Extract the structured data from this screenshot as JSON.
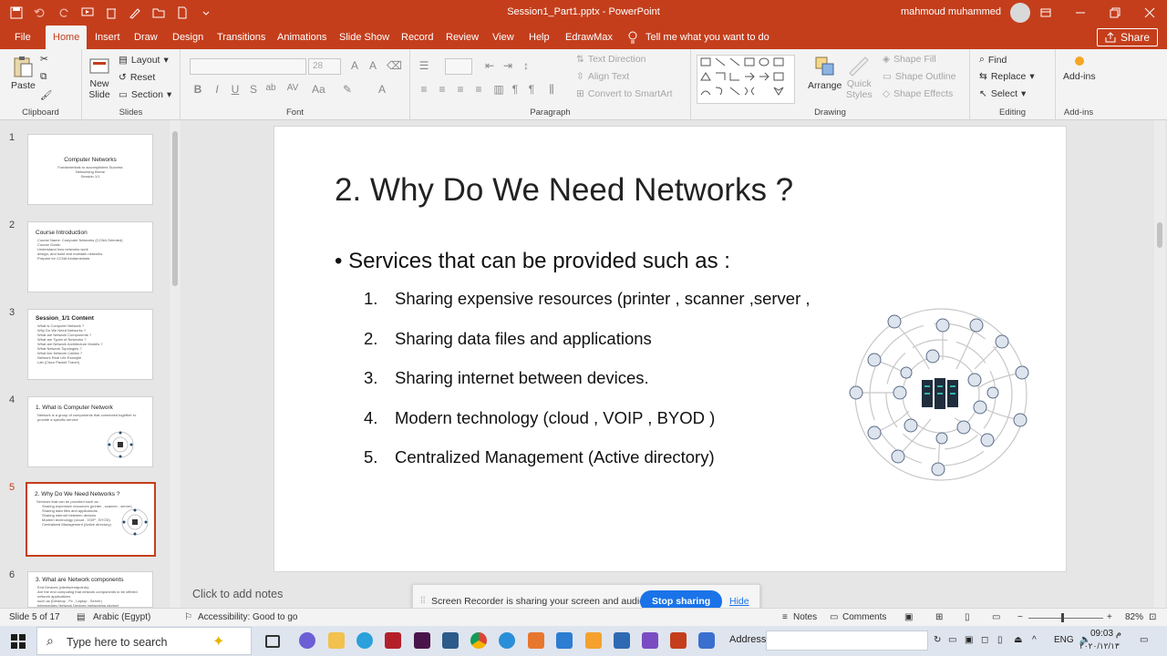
{
  "window": {
    "title": "Session1_Part1.pptx - PowerPoint",
    "user": "mahmoud muhammed"
  },
  "tabs": [
    "File",
    "Home",
    "Insert",
    "Draw",
    "Design",
    "Transitions",
    "Animations",
    "Slide Show",
    "Record",
    "Review",
    "View",
    "Help",
    "EdrawMax"
  ],
  "tell_me": "Tell me what you want to do",
  "share_label": "Share",
  "ribbon": {
    "clipboard": {
      "paste": "Paste",
      "label": "Clipboard"
    },
    "slides": {
      "new_slide_1": "New",
      "new_slide_2": "Slide",
      "layout": "Layout",
      "reset": "Reset",
      "section": "Section",
      "label": "Slides"
    },
    "font": {
      "label": "Font",
      "size": "28"
    },
    "paragraph": {
      "text_direction": "Text Direction",
      "align_text": "Align Text",
      "convert_smartart": "Convert to SmartArt",
      "label": "Paragraph"
    },
    "drawing": {
      "arrange": "Arrange",
      "quick_styles_1": "Quick",
      "quick_styles_2": "Styles",
      "shape_fill": "Shape Fill",
      "shape_outline": "Shape Outline",
      "shape_effects": "Shape Effects",
      "label": "Drawing"
    },
    "editing": {
      "find": "Find",
      "replace": "Replace",
      "select": "Select",
      "label": "Editing"
    },
    "addins": {
      "addins": "Add-ins",
      "label": "Add-ins"
    }
  },
  "thumbnails": [
    {
      "num": "1",
      "title": "Computer Networks",
      "lines": [
        "Fundamentals to accomplishes Success",
        "Networking theme",
        "Session 1/1"
      ]
    },
    {
      "num": "2",
      "title": "Course Introduction",
      "lines": [
        "Course Name: Computer Networks (CCNA Oriented)",
        "Course Goals:",
        "Understand how networks work",
        "design, and build and maintain networks",
        "Prepare for CCNA fundamentals"
      ]
    },
    {
      "num": "3",
      "title": "Session_1/1 Content",
      "lines": [
        "What is Computer Network ?",
        "Why Do We Need Networks ?",
        "What are Network Components ?",
        "What are Types of Networks ?",
        "What are Network Architecture Models ?",
        "What Network Topologies ?",
        "What Are Network Cables ?",
        "Network Real Life Example",
        "Lab (Cisco Packet Tracer)"
      ]
    },
    {
      "num": "4",
      "title": "1. What is Computer Network",
      "lines": [
        "Network is a group of components that connected together to",
        "provide a specific service"
      ]
    },
    {
      "num": "5",
      "title": "2. Why Do We Need Networks ?",
      "lines": [
        "Services that can be provided such as :",
        "Sharing expensive resources (printer , scanner , server)",
        "Sharing data files and applications",
        "Sharing internet between devices",
        "Modern technology (cloud , VOIP , BYOD)",
        "Centralized Management (Active directory)"
      ]
    },
    {
      "num": "6",
      "title": "3. What are Network components",
      "lines": [
        "End Devices (clients/endpoints):",
        "Are the end computing that network components to be offered network applications",
        "such as (Desktop , Pc , Laptop , Server)",
        "Intermediary Network Devices (networking device)"
      ]
    }
  ],
  "slide": {
    "title": "2. Why Do We Need Networks ?",
    "bullet": "Services that can be provided such as :",
    "items": [
      {
        "num": "1.",
        "text": "Sharing expensive resources (printer , scanner ,server ,"
      },
      {
        "num": "2.",
        "text": "Sharing data files and applications"
      },
      {
        "num": "3.",
        "text": "Sharing internet between devices."
      },
      {
        "num": "4.",
        "text": "Modern technology (cloud , VOIP , BYOD )"
      },
      {
        "num": "5.",
        "text": "Centralized Management (Active directory)"
      }
    ]
  },
  "notes_placeholder": "Click to add notes",
  "screen_share": {
    "message": "Screen Recorder is sharing your screen and audio.",
    "stop": "Stop sharing",
    "hide": "Hide"
  },
  "status": {
    "slide_of": "Slide 5 of 17",
    "language": "Arabic (Egypt)",
    "accessibility": "Accessibility: Good to go",
    "notes": "Notes",
    "comments": "Comments",
    "zoom": "82%"
  },
  "taskbar": {
    "search": "Type here to search",
    "address": "Address",
    "lang": "ENG",
    "time": "09:03 م",
    "date": "٢٠٢٠/١٢/١٣"
  }
}
